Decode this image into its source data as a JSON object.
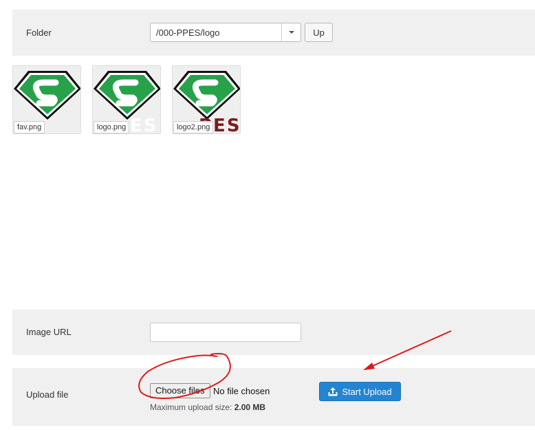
{
  "folder": {
    "label": "Folder",
    "selected": "/000-PPES/logo",
    "up_label": "Up"
  },
  "images": [
    {
      "name": "fav.png",
      "brand_text": ""
    },
    {
      "name": "logo.png",
      "brand_text": "ES"
    },
    {
      "name": "logo2.png",
      "brand_text": "PES"
    }
  ],
  "image_url": {
    "label": "Image URL",
    "value": ""
  },
  "upload": {
    "label": "Upload file",
    "choose_label": "Choose files",
    "status": "No file chosen",
    "max_label": "Maximum upload size:",
    "max_value": "2.00 MB",
    "start_label": "Start Upload"
  },
  "colors": {
    "accent": "#2384d3",
    "logo_green": "#27a24a",
    "brand_dark_red": "#7b1d1d",
    "annotation_red": "#e01818"
  },
  "icons": {
    "upload": "upload-icon",
    "dropdown": "caret-down-icon"
  }
}
